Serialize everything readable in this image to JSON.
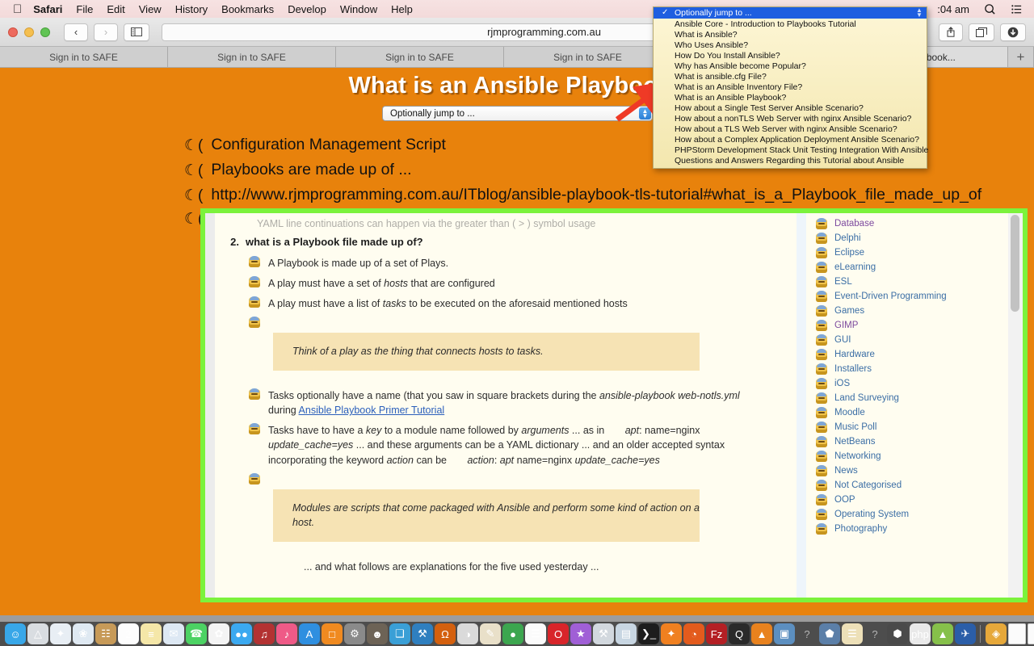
{
  "menubar": {
    "apple_icon": "apple-icon",
    "items": [
      {
        "label": "Safari",
        "bold": true
      },
      {
        "label": "File",
        "bold": false
      },
      {
        "label": "Edit",
        "bold": false
      },
      {
        "label": "View",
        "bold": false
      },
      {
        "label": "History",
        "bold": false
      },
      {
        "label": "Bookmarks",
        "bold": false
      },
      {
        "label": "Develop",
        "bold": false
      },
      {
        "label": "Window",
        "bold": false
      },
      {
        "label": "Help",
        "bold": false
      }
    ],
    "clock": ":04 am",
    "search_icon": "search-icon",
    "control_center_icon": "list-icon"
  },
  "browser": {
    "back_label": "‹",
    "forward_label": "›",
    "sidebar_icon": "sidebar-icon",
    "url": "rjmprogramming.com.au",
    "share_icon": "share-icon",
    "tab_overview_icon": "tab-overview-icon",
    "downloads_icon": "downloads-icon",
    "new_tab_label": "+",
    "tabs": [
      {
        "label": "Sign in to SAFE",
        "active": false
      },
      {
        "label": "Sign in to SAFE",
        "active": false
      },
      {
        "label": "Sign in to SAFE",
        "active": false
      },
      {
        "label": "Sign in to SAFE",
        "active": false
      },
      {
        "label": "",
        "active": false
      },
      {
        "label": "ble Playbook...",
        "active": true
      }
    ]
  },
  "slide": {
    "title": "What is an Ansible Playbook?",
    "jump_select_value": "Optionally jump to ...",
    "bullet_glyph": "☾(",
    "bullets": [
      "Configuration Management Script",
      "Playbooks are made up of ...",
      "http://www.rjmprogramming.com.au/ITblog/ansible-playbook-tls-tutorial#what_is_a_Playbook_file_made_up_of",
      ""
    ]
  },
  "dropdown": {
    "selected": "Optionally jump to ...",
    "check_glyph": "✓",
    "stepper_glyph": "⌃⌄",
    "items": [
      "Ansible Core - Introduction to Playbooks Tutorial",
      "What is Ansible?",
      "Who Uses Ansible?",
      "How Do You Install Ansible?",
      "Why has Ansible become Popular?",
      "What is ansible.cfg File?",
      "What is an Ansible Inventory File?",
      "What is an Ansible Playbook?",
      "How about a Single Test Server Ansible Scenario?",
      "How about a nonTLS Web Server with nginx Ansible Scenario?",
      "How about a TLS Web Server with nginx Ansible Scenario?",
      "How about a Complex Application Deployment Ansible Scenario?",
      "PHPStorm Development Stack Unit Testing Integration With Ansible",
      "Questions and Answers Regarding this Tutorial about Ansible"
    ]
  },
  "page": {
    "faded_line": "YAML line continuations can happen via the greater than ( > ) symbol usage",
    "section_number": "2.",
    "section_heading": "what is a Playbook file made up of?",
    "bullet_icon": "person-icon",
    "items": [
      {
        "kind": "text",
        "text": "A Playbook is made up of a set of Plays."
      },
      {
        "kind": "html",
        "text": "A play must have a set of <i>hosts</i> that are configured"
      },
      {
        "kind": "html",
        "text": "A play must have a list of <i>tasks</i> to be executed on the aforesaid mentioned hosts"
      }
    ],
    "quote1": "Think of a play as the thing that connects hosts to tasks.",
    "para_name_line1": "Tasks optionally have a name (that you saw in square brackets during the",
    "para_name_em": "ansible-playbook web-notls.yml",
    "para_name_line2_pre": "during",
    "para_name_link": "Ansible Playbook Primer Tutorial",
    "para_key_html": "Tasks have to have a <i>key</i> to a module name followed by <i>arguments</i> ... as in <span class=\"mono-gap\"></span><i>apt</i>: name=nginx <i>update_cache=yes</i> ... and these arguments can be a YAML dictionary ... and an older accepted syntax incorporating the keyword <i>action</i> can be <span class=\"mono-gap\"></span><i>action</i>: <i>apt</i> name=nginx <i>update_cache=yes</i>",
    "quote2": "Modules are scripts that come packaged with Ansible and perform some kind of action on a host.",
    "tail": "... and what follows are explanations for the five used yesterday ...",
    "categories": [
      {
        "label": "Database",
        "visited": true
      },
      {
        "label": "Delphi",
        "visited": false
      },
      {
        "label": "Eclipse",
        "visited": false
      },
      {
        "label": "eLearning",
        "visited": false
      },
      {
        "label": "ESL",
        "visited": false
      },
      {
        "label": "Event-Driven Programming",
        "visited": false
      },
      {
        "label": "Games",
        "visited": false
      },
      {
        "label": "GIMP",
        "visited": true
      },
      {
        "label": "GUI",
        "visited": false
      },
      {
        "label": "Hardware",
        "visited": false
      },
      {
        "label": "Installers",
        "visited": false
      },
      {
        "label": "iOS",
        "visited": false
      },
      {
        "label": "Land Surveying",
        "visited": false
      },
      {
        "label": "Moodle",
        "visited": false
      },
      {
        "label": "Music Poll",
        "visited": false
      },
      {
        "label": "NetBeans",
        "visited": false
      },
      {
        "label": "Networking",
        "visited": false
      },
      {
        "label": "News",
        "visited": false
      },
      {
        "label": "Not Categorised",
        "visited": false
      },
      {
        "label": "OOP",
        "visited": false
      },
      {
        "label": "Operating System",
        "visited": false
      },
      {
        "label": "Photography",
        "visited": false
      }
    ]
  },
  "dock": {
    "apps": [
      {
        "name": "finder-icon",
        "color": "#38a7e8",
        "glyph": "☺",
        "running": true
      },
      {
        "name": "launchpad-icon",
        "color": "#d9dde1",
        "glyph": "△",
        "running": false
      },
      {
        "name": "safari-icon",
        "color": "#e8eef4",
        "glyph": "✦",
        "running": true
      },
      {
        "name": "preview-icon",
        "color": "#dfe9f2",
        "glyph": "❀",
        "running": false
      },
      {
        "name": "contacts-icon",
        "color": "#c79a58",
        "glyph": "☷",
        "running": false
      },
      {
        "name": "calendar-icon",
        "color": "#fdfdfd",
        "glyph": "2",
        "running": false
      },
      {
        "name": "notes-icon",
        "color": "#f5e7a8",
        "glyph": "≡",
        "running": false
      },
      {
        "name": "mail-icon",
        "color": "#dde8f3",
        "glyph": "✉",
        "running": false
      },
      {
        "name": "facetime-icon",
        "color": "#4cd263",
        "glyph": "☎",
        "running": false
      },
      {
        "name": "photos-icon",
        "color": "#f4f4f4",
        "glyph": "✿",
        "running": false
      },
      {
        "name": "messages-icon",
        "color": "#3ba9f0",
        "glyph": "●●",
        "running": false
      },
      {
        "name": "garageband-icon",
        "color": "#b33232",
        "glyph": "♫",
        "running": false
      },
      {
        "name": "itunes-icon",
        "color": "#ef5a87",
        "glyph": "♪",
        "running": false
      },
      {
        "name": "app-store-icon",
        "color": "#2f8fe0",
        "glyph": "A",
        "running": false
      },
      {
        "name": "ibooks-icon",
        "color": "#f08a20",
        "glyph": "□",
        "running": false
      },
      {
        "name": "system-prefs-icon",
        "color": "#8a8a8a",
        "glyph": "⚙",
        "running": false
      },
      {
        "name": "gimp-icon",
        "color": "#6d6356",
        "glyph": "☻",
        "running": false
      },
      {
        "name": "trash-app-icon",
        "color": "#3a9fd6",
        "glyph": "❑",
        "running": false
      },
      {
        "name": "tools-icon",
        "color": "#2f7fbf",
        "glyph": "⚒",
        "running": false
      },
      {
        "name": "wolfram-icon",
        "color": "#d4600e",
        "glyph": "Ω",
        "running": true
      },
      {
        "name": "ghost-icon",
        "color": "#dadada",
        "glyph": "◑",
        "running": false
      },
      {
        "name": "paint-icon",
        "color": "#e9e0c9",
        "glyph": "✎",
        "running": false
      },
      {
        "name": "chrome-icon",
        "color": "#3ca64f",
        "glyph": "●",
        "running": false
      },
      {
        "name": "textedit-icon",
        "color": "#fbfbfb",
        "glyph": "☰",
        "running": false
      },
      {
        "name": "opera-icon",
        "color": "#d8252a",
        "glyph": "O",
        "running": false
      },
      {
        "name": "imovie-icon",
        "color": "#a05fd6",
        "glyph": "★",
        "running": true
      },
      {
        "name": "xcode-icon",
        "color": "#d2d8de",
        "glyph": "⚒",
        "running": false
      },
      {
        "name": "scanner-icon",
        "color": "#c8d6e2",
        "glyph": "▤",
        "running": true
      },
      {
        "name": "terminal-icon",
        "color": "#1d1d1d",
        "glyph": "❯_",
        "running": true
      },
      {
        "name": "avast-icon",
        "color": "#f08020",
        "glyph": "✦",
        "running": true
      },
      {
        "name": "firefox-icon",
        "color": "#e35b1d",
        "glyph": "◔",
        "running": true
      },
      {
        "name": "filezilla-icon",
        "color": "#b41f24",
        "glyph": "Fz",
        "running": true
      },
      {
        "name": "quicktime-icon",
        "color": "#2a2a2a",
        "glyph": "Q",
        "running": false
      },
      {
        "name": "vlc-icon",
        "color": "#e8821e",
        "glyph": "▲",
        "running": false
      },
      {
        "name": "remote-desktop-icon",
        "color": "#5c8fc0",
        "glyph": "▣",
        "running": false
      },
      {
        "name": "unknown-app-1-icon",
        "color": "transparent",
        "glyph": "?",
        "running": false
      },
      {
        "name": "virtualbox-icon",
        "color": "#5b7fa8",
        "glyph": "⬟",
        "running": false
      },
      {
        "name": "notes2-icon",
        "color": "#ede0b8",
        "glyph": "☰",
        "running": false
      },
      {
        "name": "unknown-app-2-icon",
        "color": "transparent",
        "glyph": "?",
        "running": false
      },
      {
        "name": "virtualbox2-icon",
        "color": "#4a4a4a",
        "glyph": "⬢",
        "running": false
      },
      {
        "name": "php-storm-icon",
        "color": "#e9e9e9",
        "glyph": "php",
        "running": false
      },
      {
        "name": "android-studio-icon",
        "color": "#86c04a",
        "glyph": "▲",
        "running": false
      },
      {
        "name": "twitter-icon",
        "color": "#2b5ea8",
        "glyph": "✈",
        "running": false
      }
    ],
    "documents": [
      {
        "name": "downloads-stack-icon",
        "kind": "stack"
      },
      {
        "name": "document-icon",
        "kind": "doc"
      },
      {
        "name": "document-icon",
        "kind": "doc"
      },
      {
        "name": "document-icon",
        "kind": "doc"
      },
      {
        "name": "document-icon",
        "kind": "doc"
      },
      {
        "name": "document-icon",
        "kind": "doc"
      },
      {
        "name": "document-icon",
        "kind": "doc"
      },
      {
        "name": "document-icon",
        "kind": "doc"
      }
    ],
    "trash_icon": "trash-icon"
  }
}
